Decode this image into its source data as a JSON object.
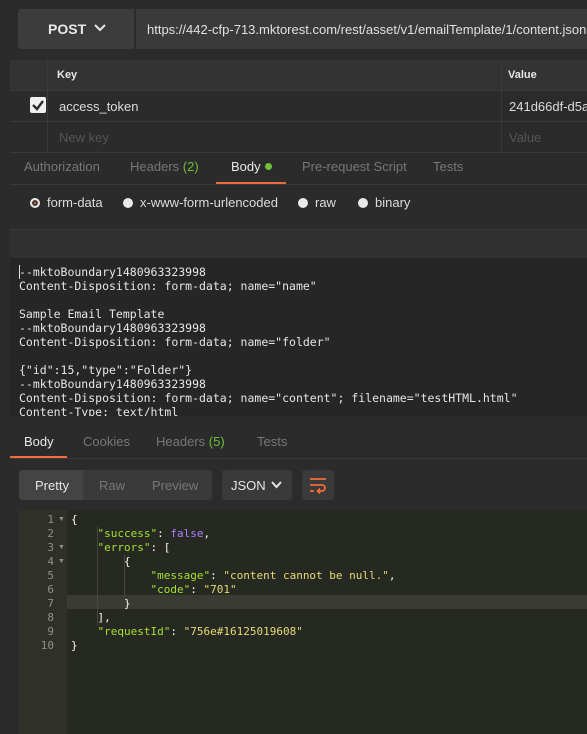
{
  "request": {
    "method": "POST",
    "url": "https://442-cfp-713.mktorest.com/rest/asset/v1/emailTemplate/1/content.json?"
  },
  "params": {
    "headers": {
      "key": "Key",
      "value": "Value"
    },
    "rows": [
      {
        "checked": true,
        "key": "access_token",
        "value": "241d66df-d5a"
      }
    ],
    "placeholder": {
      "key": "New key",
      "value": "Value"
    }
  },
  "request_tabs": {
    "authorization": "Authorization",
    "headers": "Headers",
    "headers_count": "(2)",
    "body": "Body",
    "prerequest": "Pre-request Script",
    "tests": "Tests"
  },
  "body_types": {
    "form_data": "form-data",
    "urlencoded": "x-www-form-urlencoded",
    "raw": "raw",
    "binary": "binary",
    "selected": "form-data"
  },
  "raw_body": [
    "--mktoBoundary1480963323998",
    "Content-Disposition: form-data; name=\"name\"",
    "",
    "Sample Email Template",
    "--mktoBoundary1480963323998",
    "Content-Disposition: form-data; name=\"folder\"",
    "",
    "{\"id\":15,\"type\":\"Folder\"}",
    "--mktoBoundary1480963323998",
    "Content-Disposition: form-data; name=\"content\"; filename=\"testHTML.html\"",
    "Content-Type: text/html"
  ],
  "response_tabs": {
    "body": "Body",
    "cookies": "Cookies",
    "headers": "Headers",
    "headers_count": "(5)",
    "tests": "Tests"
  },
  "response_toolbar": {
    "pretty": "Pretty",
    "raw": "Raw",
    "preview": "Preview",
    "format": "JSON"
  },
  "response_code": {
    "line_numbers": [
      "1",
      "2",
      "3",
      "4",
      "5",
      "6",
      "7",
      "8",
      "9",
      "10"
    ],
    "success_key": "\"success\"",
    "success_val": "false",
    "errors_key": "\"errors\"",
    "message_key": "\"message\"",
    "message_val": "\"content cannot be null.\"",
    "code_key": "\"code\"",
    "code_val": "\"701\"",
    "requestid_key": "\"requestId\"",
    "requestid_val": "\"756e#16125019608\""
  },
  "colors": {
    "accent": "#f26b3a",
    "badge_green": "#6fbf3a"
  }
}
